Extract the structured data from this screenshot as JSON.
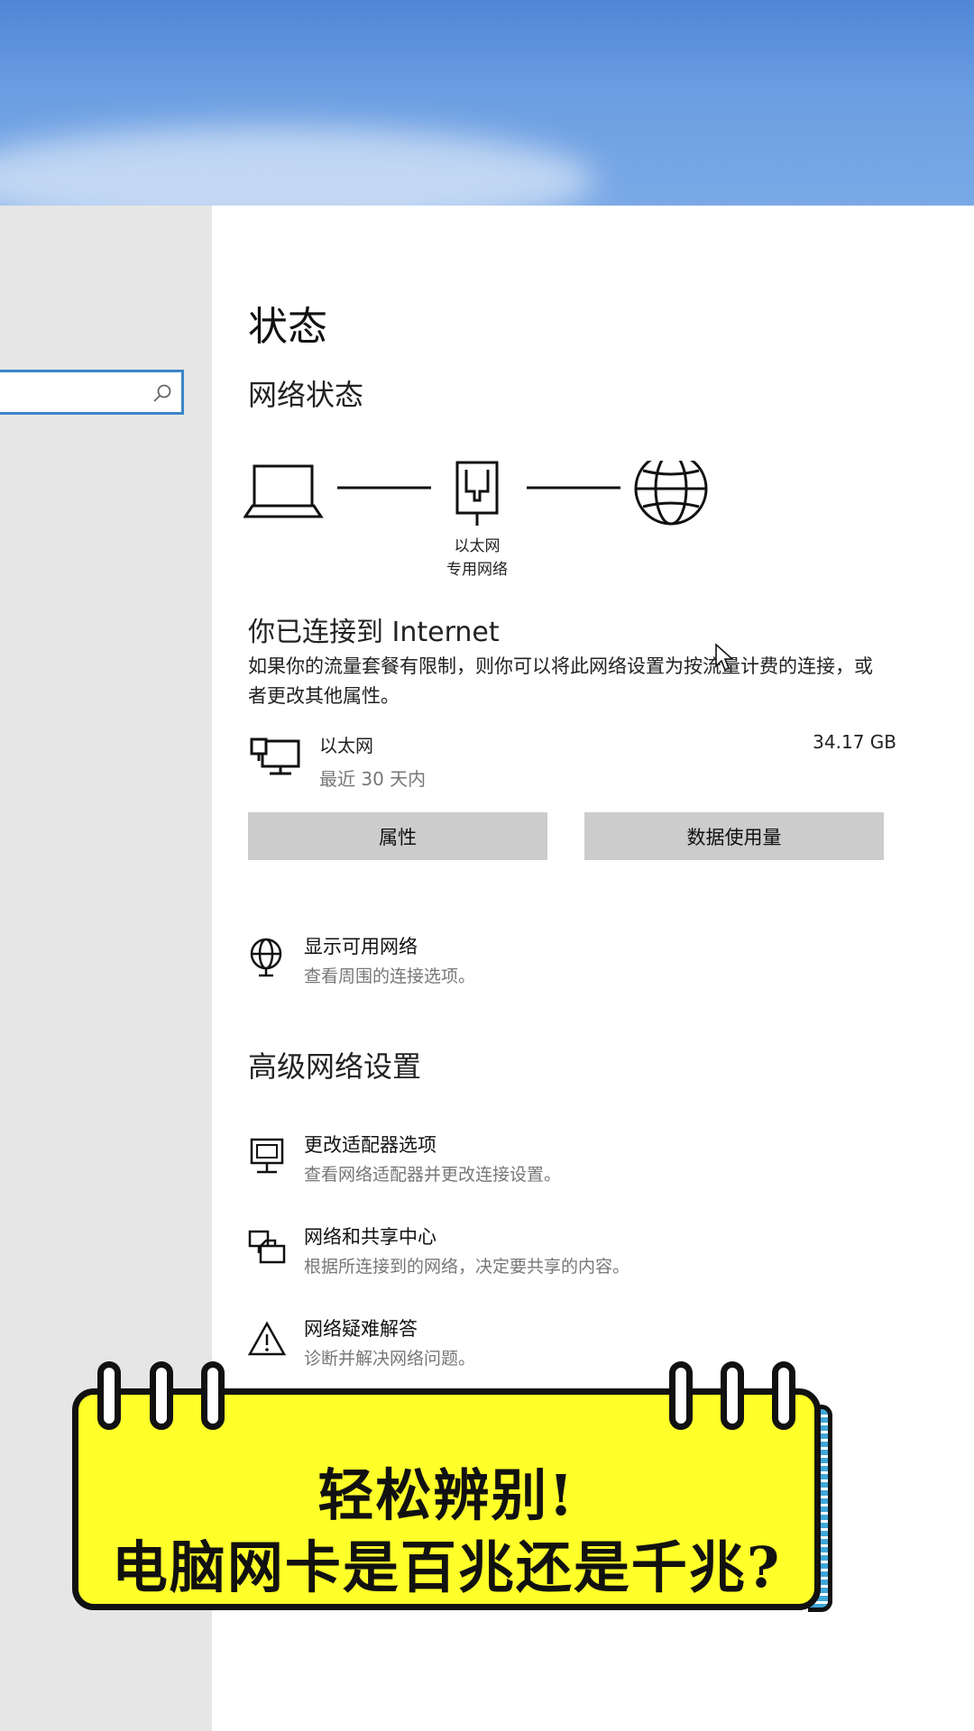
{
  "settings": {
    "page_title": "状态",
    "network_status_heading": "网络状态",
    "diagram": {
      "adapter_label": "以太网",
      "network_profile_label": "专用网络"
    },
    "connected_text": "你已连接到 Internet",
    "description": "如果你的流量套餐有限制，则你可以将此网络设置为按流量计费的连接，或者更改其他属性。",
    "connection": {
      "name": "以太网",
      "period": "最近 30 天内",
      "usage": "34.17 GB"
    },
    "buttons": {
      "properties": "属性",
      "data_usage": "数据使用量"
    },
    "show_networks": {
      "title": "显示可用网络",
      "desc": "查看周围的连接选项。"
    },
    "advanced_heading": "高级网络设置",
    "advanced_items": [
      {
        "title": "更改适配器选项",
        "desc": "查看网络适配器并更改连接设置。",
        "icon": "adapter-icon"
      },
      {
        "title": "网络和共享中心",
        "desc": "根据所连接到的网络，决定要共享的内容。",
        "icon": "sharing-center-icon"
      },
      {
        "title": "网络疑难解答",
        "desc": "诊断并解决网络问题。",
        "icon": "warning-icon"
      }
    ]
  },
  "overlay": {
    "line1": "轻松辨别!",
    "line2": "电脑网卡是百兆还是千兆?"
  },
  "colors": {
    "accent": "#3a86c8",
    "button_bg": "#cccccc",
    "banner_bg": "#ffff2a",
    "sidebar_bg": "#e6e6e6"
  }
}
